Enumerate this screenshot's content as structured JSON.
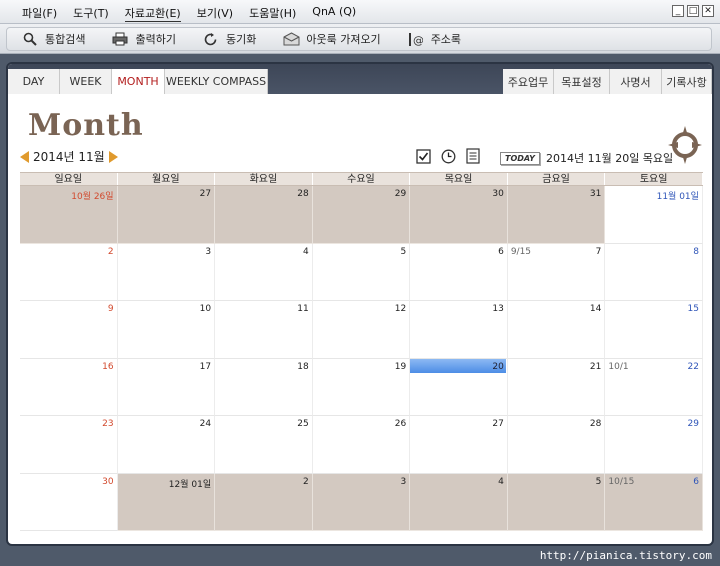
{
  "menu": {
    "items": [
      "파일(F)",
      "도구(T)",
      "자료교환(E)",
      "보기(V)",
      "도움말(H)",
      "QnA (Q)"
    ]
  },
  "toolbar": {
    "items": [
      {
        "label": "통합검색",
        "icon": "search-icon"
      },
      {
        "label": "출력하기",
        "icon": "printer-icon"
      },
      {
        "label": "동기화",
        "icon": "sync-icon"
      },
      {
        "label": "아웃룩 가져오기",
        "icon": "outlook-import-icon"
      },
      {
        "label": "주소록",
        "icon": "address-book-icon"
      }
    ]
  },
  "tabs": {
    "left": [
      "DAY",
      "WEEK",
      "MONTH",
      "WEEKLY COMPASS"
    ],
    "right": [
      "주요업무",
      "목표설정",
      "사명서",
      "기록사항"
    ],
    "active": "MONTH"
  },
  "header": {
    "title": "Month",
    "month_label": "2014년 11월",
    "today_badge": "TODAY",
    "today_date": "2014년 11월 20일 목요일"
  },
  "calendar": {
    "weekdays": [
      "일요일",
      "월요일",
      "화요일",
      "수요일",
      "목요일",
      "금요일",
      "토요일"
    ],
    "weeks": [
      [
        {
          "d": "10월 26일",
          "o": 1,
          "t": "sun"
        },
        {
          "d": "27",
          "o": 1
        },
        {
          "d": "28",
          "o": 1
        },
        {
          "d": "29",
          "o": 1
        },
        {
          "d": "30",
          "o": 1
        },
        {
          "d": "31",
          "o": 1
        },
        {
          "d": "11월 01일",
          "t": "sat"
        }
      ],
      [
        {
          "d": "2",
          "t": "sun"
        },
        {
          "d": "3"
        },
        {
          "d": "4"
        },
        {
          "d": "5"
        },
        {
          "d": "6"
        },
        {
          "d": "7",
          "n": "9/15"
        },
        {
          "d": "8",
          "t": "sat"
        }
      ],
      [
        {
          "d": "9",
          "t": "sun"
        },
        {
          "d": "10"
        },
        {
          "d": "11"
        },
        {
          "d": "12"
        },
        {
          "d": "13"
        },
        {
          "d": "14"
        },
        {
          "d": "15",
          "t": "sat"
        }
      ],
      [
        {
          "d": "16",
          "t": "sun"
        },
        {
          "d": "17"
        },
        {
          "d": "18"
        },
        {
          "d": "19"
        },
        {
          "d": "20",
          "h": 1
        },
        {
          "d": "21"
        },
        {
          "d": "22",
          "t": "sat",
          "n": "10/1"
        }
      ],
      [
        {
          "d": "23",
          "t": "sun"
        },
        {
          "d": "24"
        },
        {
          "d": "25"
        },
        {
          "d": "26"
        },
        {
          "d": "27"
        },
        {
          "d": "28"
        },
        {
          "d": "29",
          "t": "sat"
        }
      ],
      [
        {
          "d": "30",
          "t": "sun"
        },
        {
          "d": "12월 01일",
          "o": 1
        },
        {
          "d": "2",
          "o": 1
        },
        {
          "d": "3",
          "o": 1
        },
        {
          "d": "4",
          "o": 1
        },
        {
          "d": "5",
          "o": 1
        },
        {
          "d": "6",
          "o": 1,
          "t": "sat",
          "n": "10/15"
        }
      ]
    ]
  },
  "footer": {
    "watermark": "http://pianica.tistory.com"
  },
  "colors": {
    "sunday": "#d24a2e",
    "saturday": "#2f55b8",
    "other_month": "#d3c9c1",
    "accent": "#e09a2d"
  }
}
